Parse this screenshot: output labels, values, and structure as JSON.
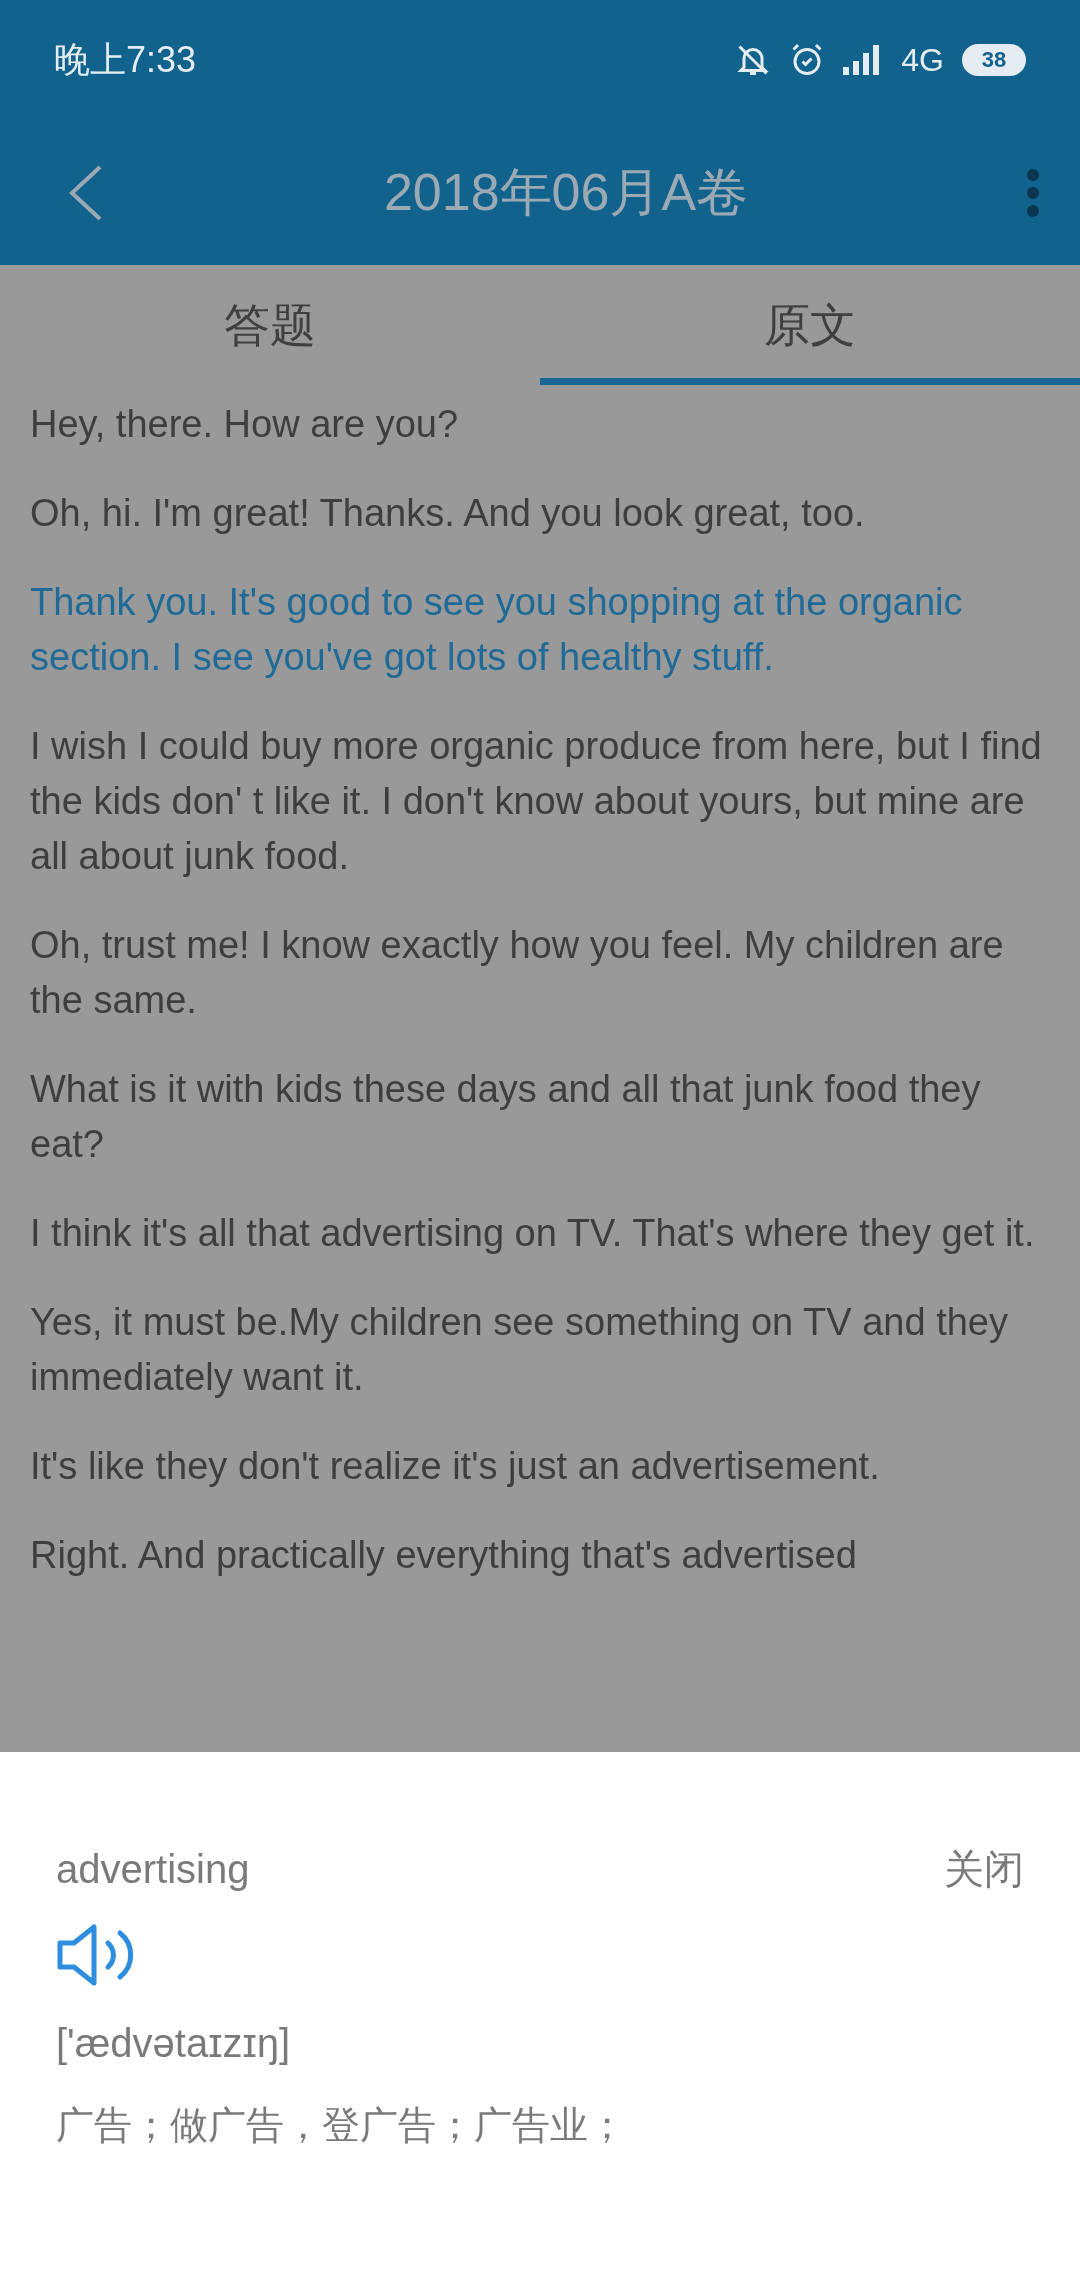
{
  "status_bar": {
    "time": "晚上7:33",
    "network": "4G",
    "battery": "38"
  },
  "header": {
    "title": "2018年06月A卷"
  },
  "tabs": [
    {
      "label": "答题",
      "selected": false
    },
    {
      "label": "原文",
      "selected": true
    }
  ],
  "transcript": [
    {
      "text": "Hey, there. How are you?",
      "highlighted": false
    },
    {
      "text": "Oh, hi. I'm great! Thanks. And you look great, too.",
      "highlighted": false
    },
    {
      "text": "Thank you. It's good to see you shopping at the organic section. I see you've got lots of healthy stuff.",
      "highlighted": true
    },
    {
      "text": "I wish I could buy more organic produce from here, but I find the kids don' t like it. I don't know about yours, but mine are all about junk food.",
      "highlighted": false
    },
    {
      "text": "Oh, trust me! I know exactly how you feel. My children are the same.",
      "highlighted": false
    },
    {
      "text": "What is it with kids these days and all that junk food they eat?",
      "highlighted": false
    },
    {
      "text": "I think it's all that advertising on TV. That's where they get it.",
      "highlighted": false
    },
    {
      "text": "Yes, it must be.My children see something on TV and they immediately want it.",
      "highlighted": false
    },
    {
      "text": "It's like they don't realize it's just an advertisement.",
      "highlighted": false
    },
    {
      "text": "Right. And practically everything that's advertised",
      "highlighted": false
    }
  ],
  "dictionary": {
    "word": "advertising",
    "close_label": "关闭",
    "phonetic": "['ædvətaɪzɪŋ]",
    "definition": "广告；做广告，登广告；广告业；"
  }
}
